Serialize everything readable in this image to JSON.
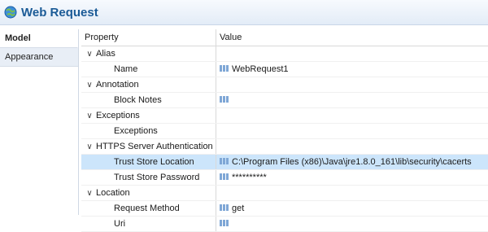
{
  "title": "Web Request",
  "tabs": [
    {
      "label": "Model",
      "active": true
    },
    {
      "label": "Appearance",
      "active": false
    }
  ],
  "columns": {
    "property": "Property",
    "value": "Value"
  },
  "rows": [
    {
      "type": "category",
      "label": "Alias"
    },
    {
      "type": "prop",
      "label": "Name",
      "value": "WebRequest1",
      "icon": true
    },
    {
      "type": "category",
      "label": "Annotation"
    },
    {
      "type": "prop",
      "label": "Block Notes",
      "value": "",
      "icon": true
    },
    {
      "type": "category",
      "label": "Exceptions"
    },
    {
      "type": "prop",
      "label": "Exceptions",
      "value": "",
      "icon": false
    },
    {
      "type": "category",
      "label": "HTTPS Server Authentication"
    },
    {
      "type": "prop",
      "label": "Trust Store Location",
      "value": "C:\\Program Files (x86)\\Java\\jre1.8.0_161\\lib\\security\\cacerts",
      "icon": true,
      "selected": true
    },
    {
      "type": "prop",
      "label": "Trust Store Password",
      "value": "**********",
      "icon": true
    },
    {
      "type": "category",
      "label": "Location"
    },
    {
      "type": "prop",
      "label": "Request Method",
      "value": "get",
      "icon": true
    },
    {
      "type": "prop",
      "label": "Uri",
      "value": "",
      "icon": true
    }
  ],
  "colors": {
    "accent": "#1a5a96",
    "selected": "#cce5fb",
    "icon": "#7fa7d6"
  },
  "icons": {
    "title": "web-request-icon",
    "field": "field-icon",
    "expand": "chevron-down-icon"
  }
}
